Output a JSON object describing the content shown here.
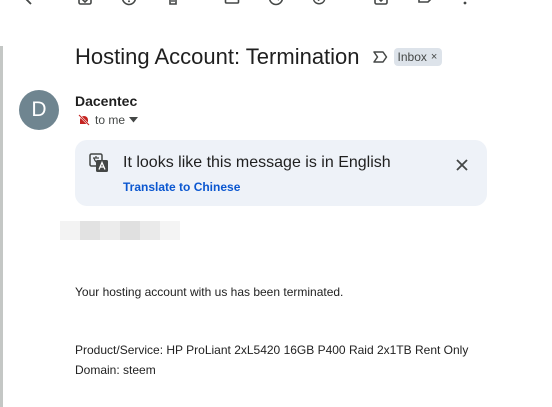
{
  "toolbar": {
    "icons": [
      "back-icon",
      "move-to-inbox-icon",
      "report-spam-icon",
      "delete-icon",
      "mark-unread-icon",
      "snooze-icon",
      "add-to-tasks-icon",
      "move-to-icon",
      "label-icon",
      "more-options-icon"
    ]
  },
  "email": {
    "subject": "Hosting Account: Termination",
    "label_chip": "Inbox",
    "label_chip_remove": "×",
    "sender": {
      "avatar_initial": "D",
      "avatar_color": "#6f8590",
      "name": "Dacentec"
    },
    "recipient": "to me",
    "translate_banner": {
      "message": "It looks like this message is in English",
      "link": "Translate to Chinese"
    },
    "body": {
      "paragraph_1": "Your hosting account with us has been terminated.",
      "product_line": "Product/Service: HP ProLiant 2xL5420 16GB P400 Raid 2x1TB Rent Only",
      "domain_line": "Domain: steem"
    }
  },
  "colors": {
    "link_blue": "#0b57d0",
    "banner_bg": "#eef2f8",
    "chip_bg": "#dde3ea",
    "text_primary": "#1f1f1f",
    "text_secondary": "#444746"
  }
}
